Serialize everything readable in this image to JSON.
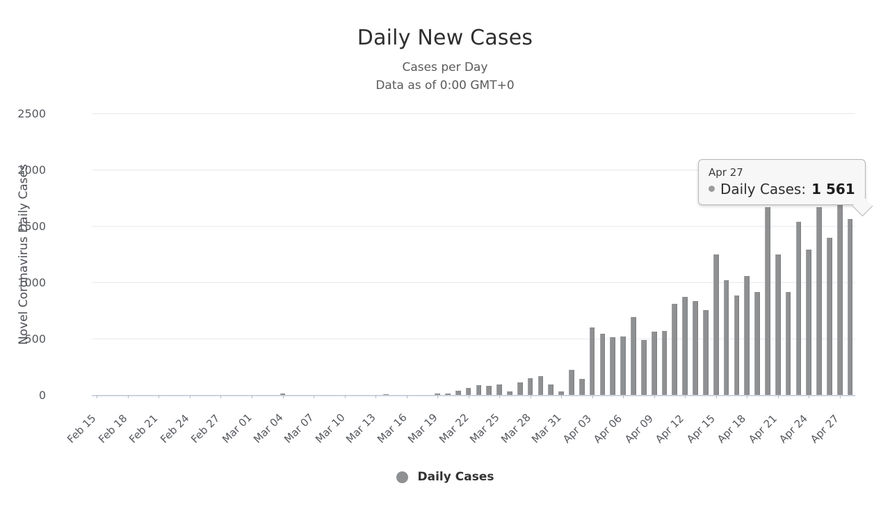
{
  "header": {
    "title": "Daily New Cases",
    "subtitle_line1": "Cases per Day",
    "subtitle_line2": "Data as of 0:00 GMT+0"
  },
  "legend": {
    "label": "Daily Cases",
    "marker_color": "#8e9092"
  },
  "tooltip": {
    "date": "Apr 27",
    "series_label": "Daily Cases:",
    "value": "1 561"
  },
  "chart_data": {
    "type": "bar",
    "title": "Daily New Cases",
    "subtitle": "Cases per Day / Data as of 0:00 GMT+0",
    "xlabel": "",
    "ylabel": "Novel Coronavirus Daily Cases",
    "ylim": [
      0,
      2500
    ],
    "yticks": [
      0,
      500,
      1000,
      1500,
      2000,
      2500
    ],
    "ytick_labels": [
      "0",
      "500",
      "1000",
      "1500",
      "2000",
      "2500"
    ],
    "grid": true,
    "legend_position": "bottom",
    "bar_color": "#8e9092",
    "series_name": "Daily Cases",
    "xtick_labels": [
      "Feb 15",
      "Feb 18",
      "Feb 21",
      "Feb 24",
      "Feb 27",
      "Mar 01",
      "Mar 04",
      "Mar 07",
      "Mar 10",
      "Mar 13",
      "Mar 16",
      "Mar 19",
      "Mar 22",
      "Mar 25",
      "Mar 28",
      "Mar 31",
      "Apr 03",
      "Apr 06",
      "Apr 09",
      "Apr 12",
      "Apr 15",
      "Apr 18",
      "Apr 21",
      "Apr 24",
      "Apr 27"
    ],
    "categories": [
      "Feb 15",
      "Feb 16",
      "Feb 17",
      "Feb 18",
      "Feb 19",
      "Feb 20",
      "Feb 21",
      "Feb 22",
      "Feb 23",
      "Feb 24",
      "Feb 25",
      "Feb 26",
      "Feb 27",
      "Feb 28",
      "Feb 29",
      "Mar 01",
      "Mar 02",
      "Mar 03",
      "Mar 04",
      "Mar 05",
      "Mar 06",
      "Mar 07",
      "Mar 08",
      "Mar 09",
      "Mar 10",
      "Mar 11",
      "Mar 12",
      "Mar 13",
      "Mar 14",
      "Mar 15",
      "Mar 16",
      "Mar 17",
      "Mar 18",
      "Mar 19",
      "Mar 20",
      "Mar 21",
      "Mar 22",
      "Mar 23",
      "Mar 24",
      "Mar 25",
      "Mar 26",
      "Mar 27",
      "Mar 28",
      "Mar 29",
      "Mar 30",
      "Mar 31",
      "Apr 01",
      "Apr 02",
      "Apr 03",
      "Apr 04",
      "Apr 05",
      "Apr 06",
      "Apr 07",
      "Apr 08",
      "Apr 09",
      "Apr 10",
      "Apr 11",
      "Apr 12",
      "Apr 13",
      "Apr 14",
      "Apr 15",
      "Apr 16",
      "Apr 17",
      "Apr 18",
      "Apr 19",
      "Apr 20",
      "Apr 21",
      "Apr 22",
      "Apr 23",
      "Apr 24",
      "Apr 25",
      "Apr 26",
      "Apr 27"
    ],
    "values": [
      0,
      0,
      0,
      0,
      0,
      0,
      0,
      0,
      0,
      0,
      0,
      0,
      0,
      0,
      0,
      0,
      0,
      0,
      12,
      0,
      0,
      0,
      0,
      0,
      0,
      0,
      0,
      0,
      8,
      0,
      0,
      0,
      0,
      10,
      14,
      40,
      60,
      85,
      78,
      90,
      30,
      110,
      150,
      165,
      95,
      30,
      225,
      140,
      600,
      545,
      510,
      520,
      690,
      490,
      560,
      565,
      810,
      870,
      835,
      755,
      1245,
      1020,
      885,
      1055,
      915,
      1665,
      1245,
      915,
      1535,
      1290,
      1665,
      1395,
      1735,
      1561
    ]
  }
}
